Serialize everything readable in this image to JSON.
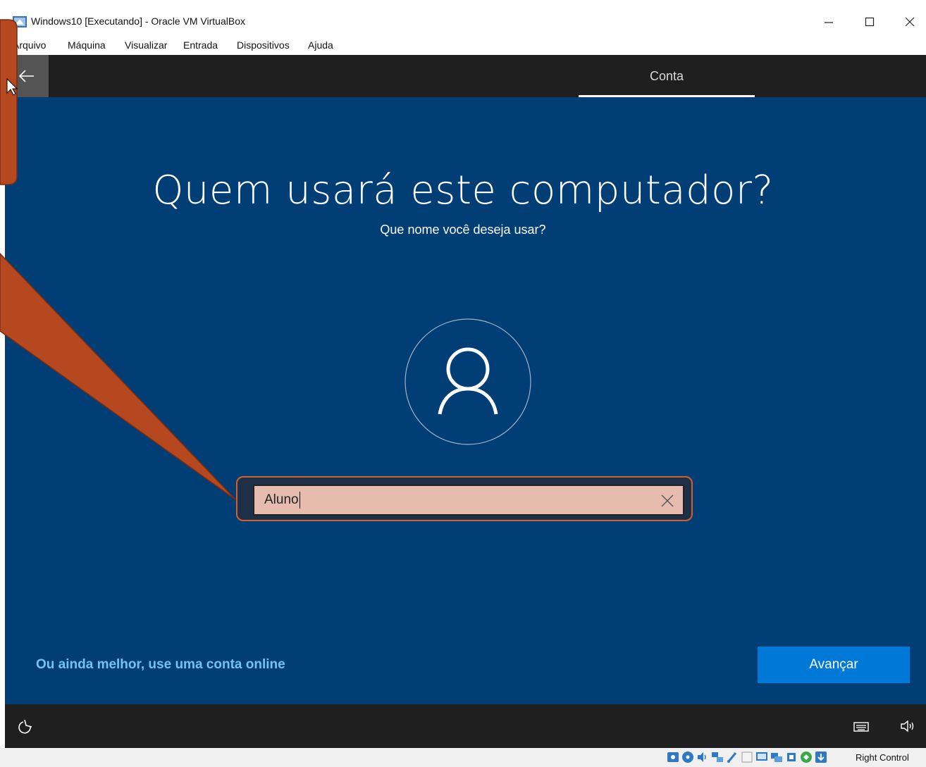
{
  "window": {
    "title": "Windows10 [Executando] - Oracle VM VirtualBox",
    "icon": "virtualbox-icon",
    "controls": [
      "minimize-icon",
      "maximize-icon",
      "close-icon"
    ]
  },
  "menu": {
    "items": [
      "Arquivo",
      "Máquina",
      "Visualizar",
      "Entrada",
      "Dispositivos",
      "Ajuda"
    ]
  },
  "oobe": {
    "back_icon": "back-arrow-icon",
    "step_label": "Conta",
    "title": "Quem usará este computador?",
    "subtitle": "Que nome você deseja usar?",
    "avatar_icon": "user-avatar-icon",
    "name_input": {
      "value": "Aluno",
      "clear_icon": "clear-x-icon"
    },
    "online_link": "Ou ainda melhor, use uma conta online",
    "next_button": "Avançar",
    "bottom_icons": [
      "ease-of-access-icon",
      "keyboard-icon",
      "volume-icon"
    ]
  },
  "statusbar": {
    "host_key": "Right Control",
    "icons": [
      "hard-disk-icon",
      "optical-drive-icon",
      "audio-icon",
      "network-icon",
      "usb-icon",
      "shared-folders-icon",
      "display-icon",
      "recording-icon",
      "cpu-icon",
      "mouse-integration-icon",
      "host-key-icon"
    ]
  },
  "colors": {
    "oobe_background": "#003e75",
    "oobe_bars": "#1f1f1f",
    "accent_button": "#0078d7",
    "link": "#72c3f2",
    "callout_fill": "#b5481e",
    "input_highlight": "#e6bcae"
  }
}
